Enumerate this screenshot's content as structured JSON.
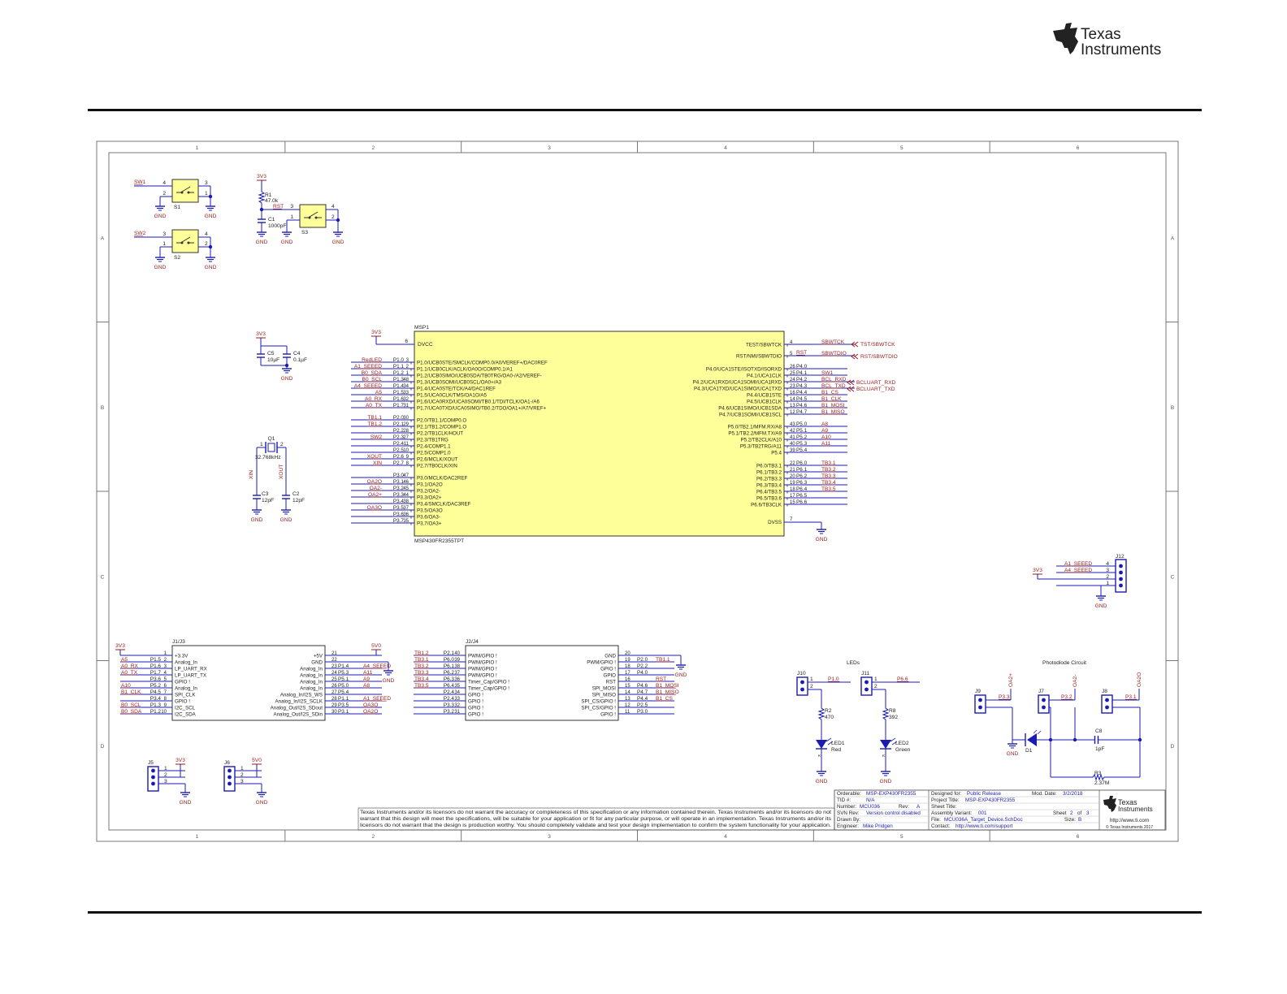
{
  "header": {
    "logo_line1": "Texas",
    "logo_line2": "Instruments"
  },
  "frame": {
    "cols": [
      "1",
      "2",
      "3",
      "4",
      "5",
      "6"
    ],
    "rows": [
      "A",
      "B",
      "C",
      "D"
    ]
  },
  "colors": {
    "wire": "#1b1bb3",
    "net": "#9b1b1b",
    "part": "#ffff99",
    "frame": "#777777"
  },
  "switches": {
    "sw1": {
      "net": "SW1",
      "ref": "S1",
      "pins": [
        "4",
        "3",
        "2",
        "1"
      ],
      "gnd": [
        "GND",
        "GND"
      ]
    },
    "sw2": {
      "net": "SW2",
      "ref": "S2",
      "pins": [
        "3",
        "4",
        "1",
        "2"
      ],
      "gnd": [
        "GND",
        "GND"
      ]
    },
    "rst": {
      "supply": "3V3",
      "r_ref": "R1",
      "r_val": "47.0k",
      "net": "RST",
      "c_ref": "C1",
      "c_val": "1000pF",
      "ref": "S3",
      "pins": [
        "3",
        "4",
        "1",
        "2"
      ],
      "gnd": [
        "GND",
        "GND",
        "GND"
      ]
    }
  },
  "decoupling": {
    "supply": "3V3",
    "c5": "C5",
    "c5v": "10µF",
    "c4": "C4",
    "c4v": "0.1µF",
    "gnd": "GND"
  },
  "crystal": {
    "ref": "Q1",
    "val": "32.768kHz",
    "p1": "1",
    "p2": "2",
    "xin": "XIN",
    "xout": "XOUT",
    "c3": "C3",
    "c3v": "12pF",
    "c2": "C2",
    "c2v": "12pF",
    "gnd": [
      "GND",
      "GND"
    ]
  },
  "mcu": {
    "ref": "MSP1",
    "part": "MSP430FR2355TPT",
    "supply": "3V3",
    "dvcc": "DVCC",
    "dvcc_pin": "6",
    "dvss": "DVSS",
    "dvss_pin": "7",
    "gnd": "GND",
    "left": [
      {
        "net": "RedLED",
        "port": "P1.0",
        "pin": "3",
        "fn": "P1.0/UCB0STE/SMCLK/COMP0.0/A0/VEREF+/DAC0REF"
      },
      {
        "net": "A1_SEEED",
        "port": "P1.1",
        "pin": "2",
        "fn": "P1.1/UCB0CLK/ACLK/OA0O/COMP0.1/A1"
      },
      {
        "net": "B0_SDA",
        "port": "P1.2",
        "pin": "1",
        "fn": "P1.2/UCB0SIMO/UCB0SDA/TB0TRG/OA0-/A2/VEREF-"
      },
      {
        "net": "B0_SCL",
        "port": "P1.3",
        "pin": "48",
        "fn": "P1.3/UCB0SOMI/UCB0SCL/OA0+/A3"
      },
      {
        "net": "A4_SEEED",
        "port": "P1.4",
        "pin": "34",
        "fn": "P1.4/UCA0STE/TCK/A4/DAC1REF"
      },
      {
        "net": "A5",
        "port": "P1.5",
        "pin": "33",
        "fn": "P1.5/UCA0CLK/TMS/OA1O/A5"
      },
      {
        "net": "A0_RX",
        "port": "P1.6",
        "pin": "32",
        "fn": "P1.6/UCA0RXD/UCA0SOMI/TB0.1/TDI/TCLK/OA1-/A6"
      },
      {
        "net": "A0_TX",
        "port": "P1.7",
        "pin": "31",
        "fn": "P1.7/UCA0TXD/UCA0SIMO/TB0.2/TDO/OA1+/A7/VREF+"
      },
      {
        "net": "TB1.1",
        "port": "P2.0",
        "pin": "30",
        "fn": "P2.0/TB1.1/COMP0.O"
      },
      {
        "net": "TB1.2",
        "port": "P2.1",
        "pin": "29",
        "fn": "P2.1/TB1.2/COMP1.O"
      },
      {
        "net": "",
        "port": "P2.2",
        "pin": "28",
        "fn": "P2.2/TB1CLK/HOUT"
      },
      {
        "net": "SW2",
        "port": "P2.3",
        "pin": "27",
        "fn": "P2.3/TB1TRG"
      },
      {
        "net": "",
        "port": "P2.4",
        "pin": "11",
        "fn": "P2.4/COMP1.1"
      },
      {
        "net": "",
        "port": "P2.5",
        "pin": "10",
        "fn": "P2.5/COMP1.0"
      },
      {
        "net": "XOUT",
        "port": "P2.6",
        "pin": "9",
        "fn": "P2.6/MCLK/XOUT"
      },
      {
        "net": "XIN",
        "port": "P2.7",
        "pin": "8",
        "fn": "P2.7/TB0CLK/XIN"
      },
      {
        "net": "",
        "port": "P3.0",
        "pin": "47",
        "fn": "P3.0/MCLK/DAC2REF"
      },
      {
        "net": "OA2O",
        "port": "P3.1",
        "pin": "46",
        "fn": "P3.1/OA2O"
      },
      {
        "net": "OA2-",
        "port": "P3.2",
        "pin": "45",
        "fn": "P3.2/OA2-"
      },
      {
        "net": "OA2+",
        "port": "P3.3",
        "pin": "44",
        "fn": "P3.3/OA2+"
      },
      {
        "net": "",
        "port": "P3.4",
        "pin": "38",
        "fn": "P3.4/SMCLK/DAC3REF"
      },
      {
        "net": "OA3O",
        "port": "P3.5",
        "pin": "37",
        "fn": "P3.5/OA3O"
      },
      {
        "net": "",
        "port": "P3.6",
        "pin": "36",
        "fn": "P3.6/OA3-"
      },
      {
        "net": "",
        "port": "P3.7",
        "pin": "35",
        "fn": "P3.7/OA3+"
      }
    ],
    "right": [
      {
        "fn": "TEST/SBWTCK",
        "pin": "4",
        "port": "",
        "net": "SBWTCK"
      },
      {
        "fn": "RST/NMI/SBWTDIO",
        "pin": "5",
        "port": "",
        "net": "SBWTDIO"
      },
      {
        "fn": "P4.0/UCA1STE/ISOTXD/ISORXD",
        "pin": "26",
        "port": "P4.0",
        "net": ""
      },
      {
        "fn": "P4.1/UCA1CLK",
        "pin": "25",
        "port": "P4.1",
        "net": "SW1"
      },
      {
        "fn": "P4.2/UCA1RXD/UCA1SOMI/UCA1RXD",
        "pin": "24",
        "port": "P4.2",
        "net": "BCL_RXD"
      },
      {
        "fn": "P4.3/UCA1TXD/UCA1SIMO/UCA1TXD",
        "pin": "23",
        "port": "P4.3",
        "net": "BCL_TXD"
      },
      {
        "fn": "P4.4/UCB1STE",
        "pin": "16",
        "port": "P4.4",
        "net": "B1_CS"
      },
      {
        "fn": "P4.5/UCB1CLK",
        "pin": "14",
        "port": "P4.5",
        "net": "B1_CLK"
      },
      {
        "fn": "P4.6/UCB1SIMO/UCB1SDA",
        "pin": "13",
        "port": "P4.6",
        "net": "B1_MOSI"
      },
      {
        "fn": "P4.7/UCB1SOMI/UCB1SCL",
        "pin": "12",
        "port": "P4.7",
        "net": "B1_MISO"
      },
      {
        "fn": "P5.0/TB2.1/MFM.RX/A8",
        "pin": "43",
        "port": "P5.0",
        "net": "A8"
      },
      {
        "fn": "P5.1/TB2.2/MFM.TX/A9",
        "pin": "42",
        "port": "P5.1",
        "net": "A9"
      },
      {
        "fn": "P5.2/TB2CLK/A10",
        "pin": "41",
        "port": "P5.2",
        "net": "A10"
      },
      {
        "fn": "P5.3/TB2TRG/A11",
        "pin": "40",
        "port": "P5.3",
        "net": "A11"
      },
      {
        "fn": "P5.4",
        "pin": "39",
        "port": "P5.4",
        "net": ""
      },
      {
        "fn": "P6.0/TB3.1",
        "pin": "22",
        "port": "P6.0",
        "net": "TB3.1"
      },
      {
        "fn": "P6.1/TB3.2",
        "pin": "21",
        "port": "P6.1",
        "net": "TB3.2"
      },
      {
        "fn": "P6.2/TB3.3",
        "pin": "20",
        "port": "P6.2",
        "net": "TB3.3"
      },
      {
        "fn": "P6.3/TB3.4",
        "pin": "19",
        "port": "P6.3",
        "net": "TB3.4"
      },
      {
        "fn": "P6.4/TB3.5",
        "pin": "18",
        "port": "P6.4",
        "net": "TB3.5"
      },
      {
        "fn": "P6.5/TB3.6",
        "pin": "17",
        "port": "P6.5",
        "net": ""
      },
      {
        "fn": "P6.6/TB3CLK",
        "pin": "15",
        "port": "P6.6",
        "net": ""
      }
    ],
    "offsheet": {
      "tst": "TST/SBWTCK",
      "rstio": "RST/SBWTDIO",
      "rst": "RST",
      "rxd": "BCLUART_RXD",
      "txd": "BCLUART_TXD"
    }
  },
  "j12": {
    "ref": "J12",
    "supply": "3V3",
    "nets": [
      "A1_SEEED",
      "A4_SEEED"
    ],
    "pins": [
      "4",
      "3",
      "2",
      "1"
    ],
    "gnd": "GND"
  },
  "j1j3": {
    "ref": "J1/J3",
    "supply_l": "3V3",
    "supply_r": "5V0",
    "gnd": [
      "GND",
      "GND"
    ],
    "left": [
      {
        "net": "",
        "port": "",
        "pin": "1",
        "fn": "+3.3V"
      },
      {
        "net": "A5",
        "port": "P1.5",
        "pin": "2",
        "fn": "Analog_In"
      },
      {
        "net": "A0_RX",
        "port": "P1.6",
        "pin": "3",
        "fn": "LP_UART_RX"
      },
      {
        "net": "A0_TX",
        "port": "P1.7",
        "pin": "4",
        "fn": "LP_UART_TX"
      },
      {
        "net": "",
        "port": "P3.6",
        "pin": "5",
        "fn": "GPIO !"
      },
      {
        "net": "A10",
        "port": "P5.2",
        "pin": "6",
        "fn": "Analog_In"
      },
      {
        "net": "B1_CLK",
        "port": "P4.5",
        "pin": "7",
        "fn": "SPI_CLK"
      },
      {
        "net": "",
        "port": "P3.4",
        "pin": "8",
        "fn": "GPIO !"
      },
      {
        "net": "B0_SCL",
        "port": "P1.3",
        "pin": "9",
        "fn": "I2C_SCL"
      },
      {
        "net": "B0_SDA",
        "port": "P1.2",
        "pin": "10",
        "fn": "I2C_SDA"
      }
    ],
    "right": [
      {
        "fn": "+5V",
        "pin": "21",
        "port": "",
        "net": ""
      },
      {
        "fn": "GND",
        "pin": "22",
        "port": "",
        "net": ""
      },
      {
        "fn": "Analog_In",
        "pin": "23",
        "port": "P1.4",
        "net": "A4_SEEED"
      },
      {
        "fn": "Analog_In",
        "pin": "24",
        "port": "P5.3",
        "net": "A11"
      },
      {
        "fn": "Analog_In",
        "pin": "25",
        "port": "P5.1",
        "net": "A9"
      },
      {
        "fn": "Analog_In",
        "pin": "26",
        "port": "P5.0",
        "net": "A8"
      },
      {
        "fn": "Analog_In/I2S_WS",
        "pin": "27",
        "port": "P5.4",
        "net": ""
      },
      {
        "fn": "Analog_In/I2S_SCLK",
        "pin": "28",
        "port": "P1.1",
        "net": "A1_SEEED"
      },
      {
        "fn": "Analog_Out/I2S_SDout",
        "pin": "29",
        "port": "P3.5",
        "net": "OA3O"
      },
      {
        "fn": "Analog_Out/I2S_SDin",
        "pin": "30",
        "port": "P3.1",
        "net": "OA2O"
      }
    ]
  },
  "j2j4": {
    "ref": "J2/J4",
    "gnd": "GND",
    "left": [
      {
        "net": "TB1.2",
        "port": "P2.1",
        "pin": "40",
        "fn": "PWM/GPIO !"
      },
      {
        "net": "TB3.1",
        "port": "P6.0",
        "pin": "39",
        "fn": "PWM/GPIO !"
      },
      {
        "net": "TB3.2",
        "port": "P6.1",
        "pin": "38",
        "fn": "PWM/GPIO !"
      },
      {
        "net": "TB3.3",
        "port": "P6.2",
        "pin": "37",
        "fn": "PWM/GPIO !"
      },
      {
        "net": "TB3.4",
        "port": "P6.3",
        "pin": "36",
        "fn": "Timer_Cap/GPIO !"
      },
      {
        "net": "TB3.5",
        "port": "P6.4",
        "pin": "35",
        "fn": "Timer_Cap/GPIO !"
      },
      {
        "net": "",
        "port": "P2.4",
        "pin": "34",
        "fn": "GPIO !"
      },
      {
        "net": "",
        "port": "P2.4",
        "pin": "33",
        "fn": "GPIO !"
      },
      {
        "net": "",
        "port": "P3.3",
        "pin": "32",
        "fn": "GPIO !"
      },
      {
        "net": "",
        "port": "P3.2",
        "pin": "31",
        "fn": "GPIO !"
      }
    ],
    "right": [
      {
        "fn": "GND",
        "pin": "20",
        "port": "",
        "net": ""
      },
      {
        "fn": "PWM/GPIO !",
        "pin": "19",
        "port": "P2.0",
        "net": "TB1.1"
      },
      {
        "fn": "GPIO !",
        "pin": "18",
        "port": "P2.2",
        "net": ""
      },
      {
        "fn": "GPIO",
        "pin": "17",
        "port": "P4.0",
        "net": ""
      },
      {
        "fn": "RST",
        "pin": "16",
        "port": "",
        "net": "RST"
      },
      {
        "fn": "SPI_MOSI",
        "pin": "15",
        "port": "P4.6",
        "net": "B1_MOSI"
      },
      {
        "fn": "SPI_MISO",
        "pin": "14",
        "port": "P4.7",
        "net": "B1_MISO"
      },
      {
        "fn": "SPI_CS/GPIO !",
        "pin": "13",
        "port": "P4.4",
        "net": "B1_CS"
      },
      {
        "fn": "SPI_CS/GPIO !",
        "pin": "12",
        "port": "P2.5",
        "net": ""
      },
      {
        "fn": "GPIO !",
        "pin": "11",
        "port": "P3.0",
        "net": ""
      }
    ]
  },
  "j5": {
    "ref": "J5",
    "supply": "3V3",
    "pins": [
      "1",
      "2",
      "3"
    ],
    "gnd": "GND"
  },
  "j6": {
    "ref": "J6",
    "supply": "5V0",
    "pins": [
      "1",
      "2",
      "3"
    ],
    "gnd": "GND"
  },
  "leds": {
    "title": "LEDs",
    "j10": "J10",
    "n1": "P1.0",
    "r2": "R2",
    "r2v": "470",
    "led1": "LED1",
    "led1c": "Red",
    "j11": "J11",
    "n2": "P6.6",
    "r8": "R8",
    "r8v": "392",
    "led2": "LED2",
    "led2c": "Green",
    "gnd": [
      "GND",
      "GND"
    ],
    "k": "K",
    "p12": [
      "1",
      "2"
    ]
  },
  "photodiode": {
    "title": "Photodiode Circuit",
    "j9": "J9",
    "j7": "J7",
    "j8": "J8",
    "n9": "P3.3",
    "n7": "P3.2",
    "n8": "P3.1",
    "oa1": "OA2+",
    "oa2": "OA2-",
    "oa3": "OA2O",
    "d1": "D1",
    "c8": "C8",
    "c8v": "1pF",
    "r3": "R3",
    "r3v": "2.37M",
    "gnd": "GND"
  },
  "disclaimer": [
    "Texas Instruments and/or its licensors do not warrant the accuracy or completeness of this specification or any information contained therein. Texas Instruments and/or its licensors do not",
    "warrant that this design will meet the specifications, will be suitable for your application or fit for any particular purpose, or will operate in an implementation. Texas Instruments and/or its",
    "licensors do not warrant that the design is production worthy. You should completely validate and test your design implementation to confirm the system functionality for your application."
  ],
  "titleblock": {
    "orderable": "Orderable:",
    "orderable_v": "MSP-EXP430FR2355",
    "tid": "TID #:",
    "tid_v": "N/A",
    "number": "Number:",
    "number_v": "MCU036",
    "rev": "Rev:",
    "rev_v": "A",
    "svn": "SVN Rev:",
    "svn_v": "Version control disabled",
    "drawn": "Drawn By:",
    "engineer": "Engineer:",
    "engineer_v": "Mike Pridgen",
    "designed": "Designed for:",
    "designed_v": "Public Release",
    "moddate": "Mod. Date:",
    "moddate_v": "3/2/2018",
    "project": "Project Title:",
    "project_v": "MSP-EXP430FR2355",
    "sheet_title": "Sheet Title:",
    "variant": "Assembly Variant:",
    "variant_v": "001",
    "sheet": "Sheet",
    "sheet_v": "2",
    "of": "of",
    "of_v": "3",
    "file": "File:",
    "file_v": "MCU036A_Target_Device.SchDoc",
    "size": "Size:",
    "size_v": "B",
    "contact": "Contact:",
    "contact_v": "http://www.ti.com/support",
    "url": "http://www.ti.com",
    "copyright": "© Texas Instruments  2017",
    "logo1": "Texas",
    "logo2": "Instruments"
  }
}
